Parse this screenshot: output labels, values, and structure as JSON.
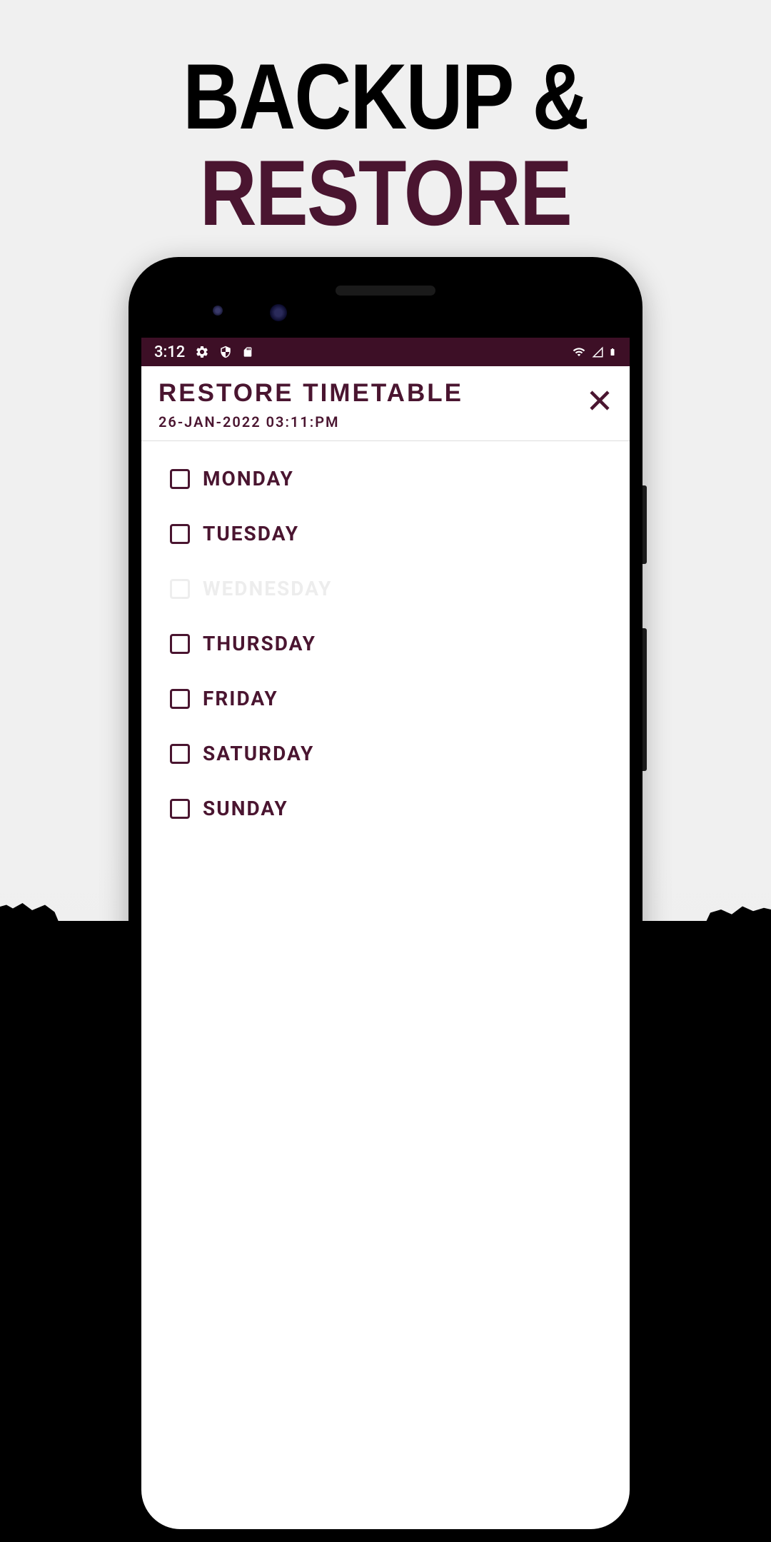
{
  "promo": {
    "line1": "BACKUP &",
    "line2": "RESTORE"
  },
  "statusBar": {
    "time": "3:12"
  },
  "header": {
    "title": "RESTORE TIMETABLE",
    "subtitle": "26-JAN-2022 03:11:PM"
  },
  "days": [
    {
      "label": "MONDAY",
      "disabled": false
    },
    {
      "label": "TUESDAY",
      "disabled": false
    },
    {
      "label": "WEDNESDAY",
      "disabled": true
    },
    {
      "label": "THURSDAY",
      "disabled": false
    },
    {
      "label": "FRIDAY",
      "disabled": false
    },
    {
      "label": "SATURDAY",
      "disabled": false
    },
    {
      "label": "SUNDAY",
      "disabled": false
    }
  ]
}
